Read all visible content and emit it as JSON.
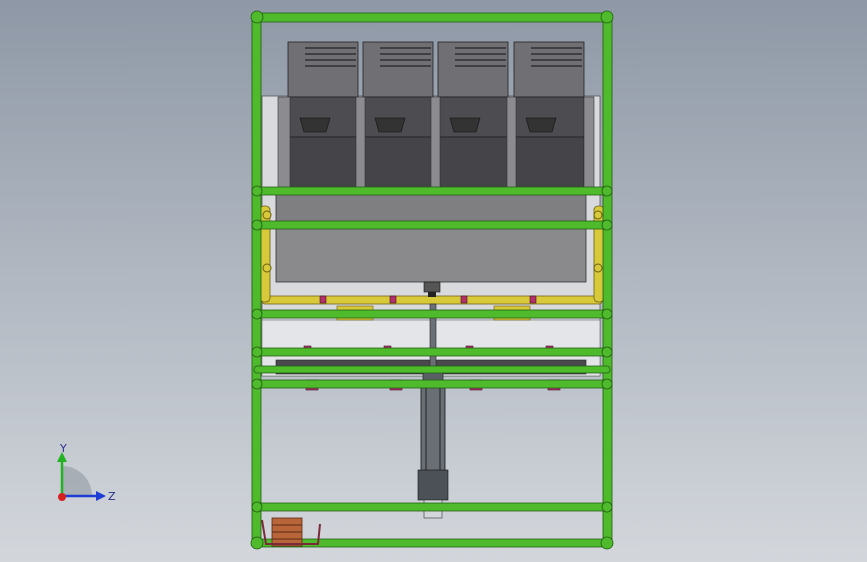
{
  "viewport": {
    "background_top": "#8e98a6",
    "background_bottom": "#d3d7dc"
  },
  "model": {
    "frame_color": "#4fba2c",
    "frame_edge": "#1e5c10",
    "rail_color": "#d8c93a",
    "block_color": "#4b4b50",
    "plate_color": "#7f7f82",
    "cylinder_color": "#5a5f66",
    "bracket_color": "#b0306a",
    "coil_color": "#b8653a",
    "module_count": 4
  },
  "triad": {
    "y_label": "Y",
    "z_label": "Z",
    "y_color": "#22b322",
    "z_color": "#1f3bd6",
    "x_color": "#d62020"
  }
}
